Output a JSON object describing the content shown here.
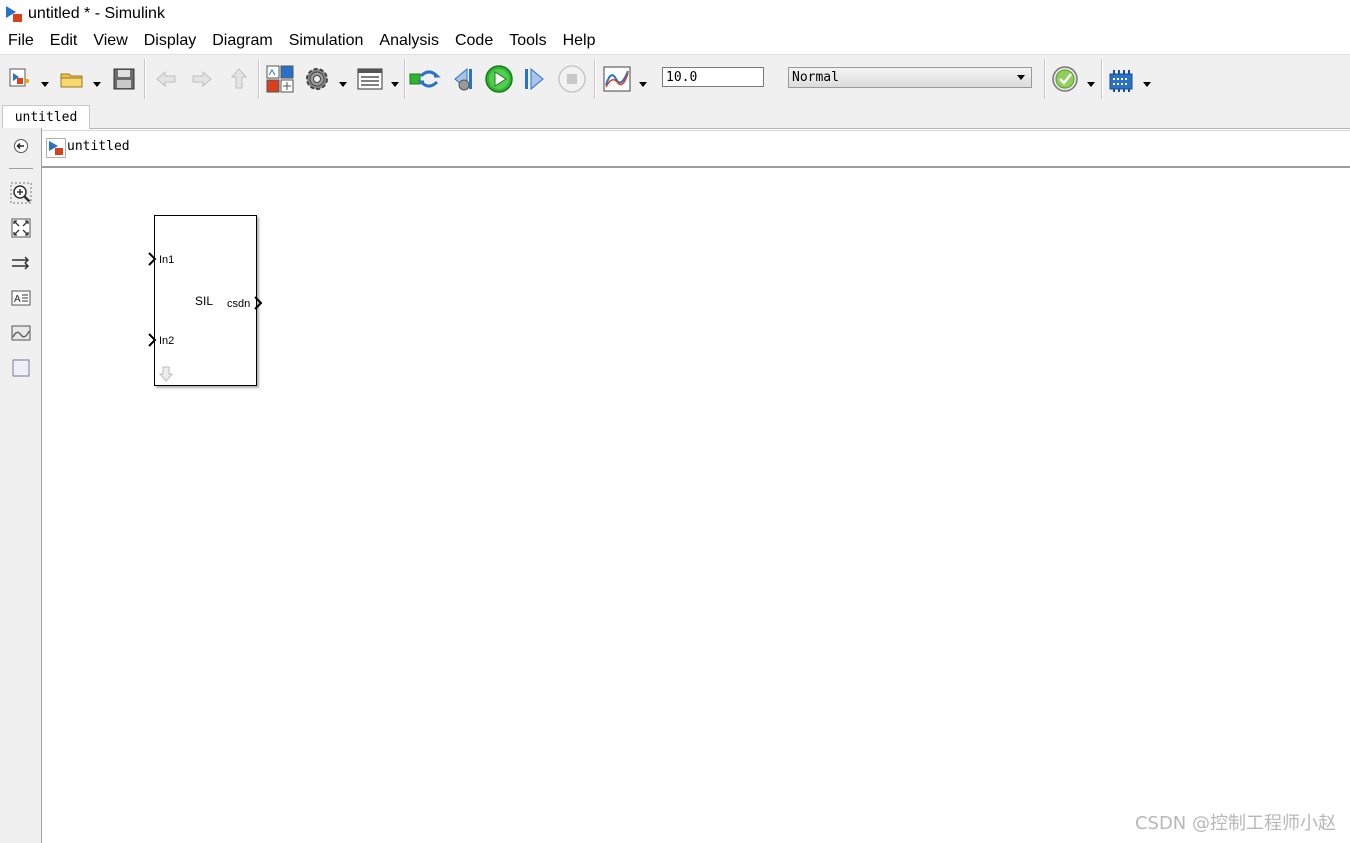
{
  "window": {
    "title": "untitled * - Simulink",
    "app_icon": "simulink-model-icon"
  },
  "menu": {
    "items": [
      "File",
      "Edit",
      "View",
      "Display",
      "Diagram",
      "Simulation",
      "Analysis",
      "Code",
      "Tools",
      "Help"
    ]
  },
  "toolbar": {
    "icons": {
      "new_model": "new-model-icon",
      "open": "open-folder-icon",
      "save": "save-icon",
      "back": "back-arrow-icon",
      "forward": "forward-arrow-icon",
      "up": "up-arrow-icon",
      "library_browser": "library-browser-icon",
      "model_settings": "gear-icon",
      "model_explorer": "model-explorer-icon",
      "update_diagram": "update-diagram-icon",
      "step_back": "step-back-icon",
      "run": "run-icon",
      "step_forward": "step-forward-icon",
      "stop": "stop-icon",
      "data_inspector": "data-inspector-icon",
      "model_advisor": "model-advisor-icon",
      "build": "build-icon"
    },
    "stop_time": "10.0",
    "simulation_mode": "Normal"
  },
  "tabs": [
    {
      "label": "untitled"
    }
  ],
  "address": {
    "path": "untitled"
  },
  "palette": {
    "icons": [
      "hide-browser-icon",
      "zoom-icon",
      "fit-to-view-icon",
      "route-lines-icon",
      "annotation-icon",
      "image-icon",
      "area-icon"
    ]
  },
  "canvas": {
    "block": {
      "name": "SIL",
      "inputs": [
        "In1",
        "In2"
      ],
      "outputs": [
        "csdn"
      ]
    }
  },
  "watermark": "CSDN @控制工程师小赵",
  "colors": {
    "run_green": "#2fb52f",
    "toolbar_bg": "#f0f0f0",
    "simulink_red": "#d9401c",
    "simulink_blue": "#2872c9"
  }
}
